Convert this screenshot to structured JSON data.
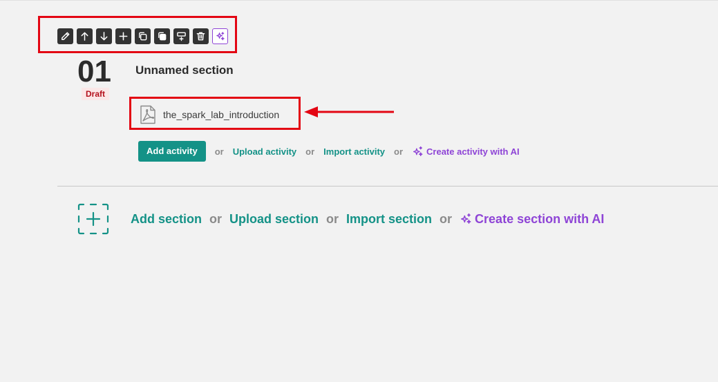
{
  "toolbar": {
    "buttons": [
      {
        "icon": "pencil-icon",
        "name": "edit-section-button"
      },
      {
        "icon": "arrow-up-icon",
        "name": "move-up-button"
      },
      {
        "icon": "arrow-down-icon",
        "name": "move-down-button"
      },
      {
        "icon": "plus-icon",
        "name": "add-button"
      },
      {
        "icon": "copy-icon",
        "name": "copy-button"
      },
      {
        "icon": "duplicate-icon",
        "name": "duplicate-button"
      },
      {
        "icon": "insert-icon",
        "name": "insert-button"
      },
      {
        "icon": "trash-icon",
        "name": "delete-button"
      },
      {
        "icon": "sparkle-icon",
        "name": "ai-button"
      }
    ]
  },
  "section": {
    "number": "01",
    "status": "Draft",
    "title": "Unnamed section"
  },
  "activity": {
    "name": "the_spark_lab_introduction",
    "icon": "pdf-file-icon"
  },
  "activity_actions": {
    "add": "Add activity",
    "or": "or",
    "upload": "Upload activity",
    "import": "Import activity",
    "ai_create": "Create activity with AI"
  },
  "section_actions": {
    "add": "Add section",
    "or": "or",
    "upload": "Upload section",
    "import": "Import section",
    "ai_create": "Create section with AI"
  },
  "colors": {
    "teal": "#149287",
    "purple": "#8e44d6",
    "annotation_red": "#e30613",
    "draft_red": "#b4101c"
  }
}
